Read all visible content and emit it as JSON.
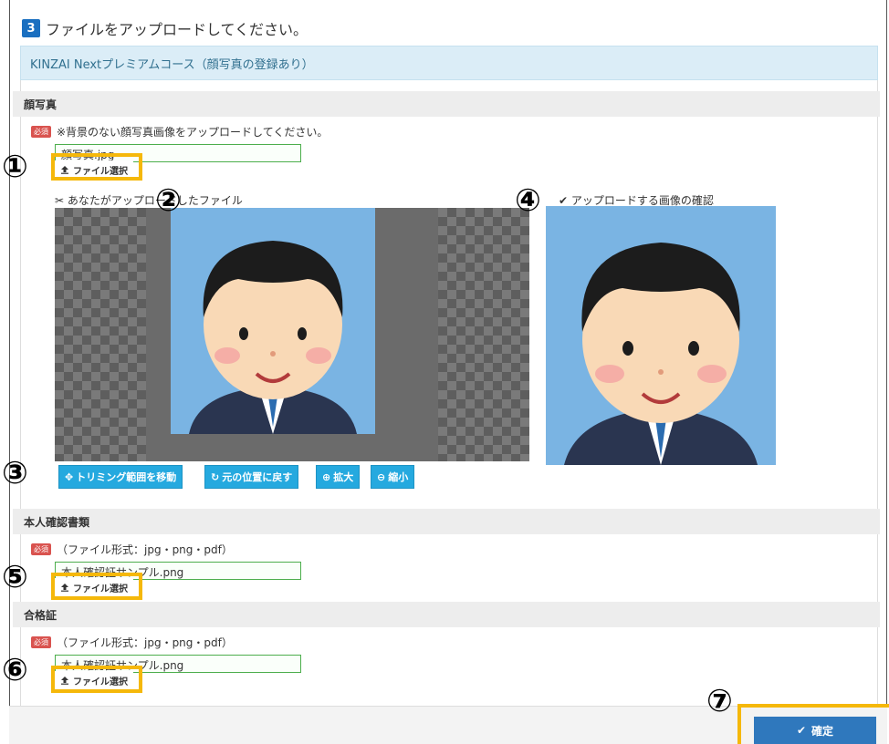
{
  "step": {
    "number": "3",
    "title": "ファイルをアップロードしてください。"
  },
  "course": {
    "name": "KINZAI Nextプレミアムコース（顔写真の登録あり）"
  },
  "required_badge": "必須",
  "markers": {
    "m1": "①",
    "m2": "②",
    "m3": "③",
    "m4": "④",
    "m5": "⑤",
    "m6": "⑥",
    "m7": "⑦"
  },
  "photo": {
    "heading": "顔写真",
    "note": "※背景のない顔写真画像をアップロードしてください。",
    "file_value": "顔写真.jpg",
    "select_label": "ファイル選択",
    "uploaded_caption": "あなたがアップロードしたファイル",
    "preview_caption": "アップロードする画像の確認",
    "tools": {
      "move": "トリミング範囲を移動",
      "reset": "元の位置に戻す",
      "zoom_in": "拡大",
      "zoom_out": "縮小"
    }
  },
  "id_doc": {
    "heading": "本人確認書類",
    "note": "（ファイル形式：jpg・png・pdf）",
    "file_value": "本人確認証サンプル.png",
    "select_label": "ファイル選択"
  },
  "certificate": {
    "heading": "合格証",
    "note": "（ファイル形式：jpg・png・pdf）",
    "file_value": "本人確認証サンプル.png",
    "select_label": "ファイル選択"
  },
  "confirm_label": "確定",
  "icons": {
    "upload": "upload-icon",
    "scissors": "scissors-icon",
    "check": "check-icon",
    "move": "move-icon",
    "reset": "refresh-icon",
    "zoom_in": "zoom-in-icon",
    "zoom_out": "zoom-out-icon",
    "confirm": "check-icon"
  },
  "colors": {
    "highlight": "#f5b80a",
    "step_badge": "#1a6fc0",
    "tool_button": "#25a9df",
    "confirm_button": "#2f78bd",
    "required_badge": "#d9534f"
  }
}
